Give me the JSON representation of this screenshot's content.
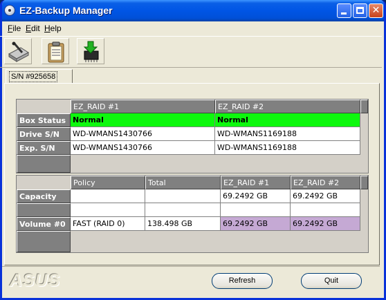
{
  "window": {
    "title": "EZ-Backup Manager",
    "close_glyph": "✕"
  },
  "menu": [
    {
      "key": "F",
      "rest": "ile"
    },
    {
      "key": "E",
      "rest": "dit"
    },
    {
      "key": "H",
      "rest": "elp"
    }
  ],
  "toolbar": {
    "icons": [
      "drive-scan-icon",
      "clipboard-icon",
      "download-chip-icon"
    ]
  },
  "tab": {
    "label": "S/N #925658"
  },
  "status_table": {
    "headers": [
      "EZ_RAID #1",
      "EZ_RAID #2"
    ],
    "rows": [
      {
        "label": "Box Status",
        "values": [
          "Normal",
          "Normal"
        ]
      },
      {
        "label": "Drive S/N",
        "values": [
          "WD-WMANS1430766",
          "WD-WMANS1169188"
        ]
      },
      {
        "label": "Exp.  S/N",
        "values": [
          "WD-WMANS1430766",
          "WD-WMANS1169188"
        ]
      }
    ],
    "status_color": "#0df80d"
  },
  "volume_table": {
    "headers": [
      "Policy",
      "Total",
      "EZ_RAID #1",
      "EZ_RAID #2"
    ],
    "rows": [
      {
        "label": "Capacity",
        "values": [
          "",
          "",
          "69.2492 GB",
          "69.2492 GB"
        ]
      },
      {
        "label": "",
        "values": [
          "",
          "",
          "",
          ""
        ]
      },
      {
        "label": "Volume #0",
        "values": [
          "FAST (RAID 0)",
          "138.498 GB",
          "69.2492 GB",
          "69.2492 GB"
        ]
      }
    ],
    "highlight_color": "#c5a9d4"
  },
  "footer": {
    "brand": "ASUS",
    "refresh_label": "Refresh",
    "quit_label": "Quit"
  }
}
